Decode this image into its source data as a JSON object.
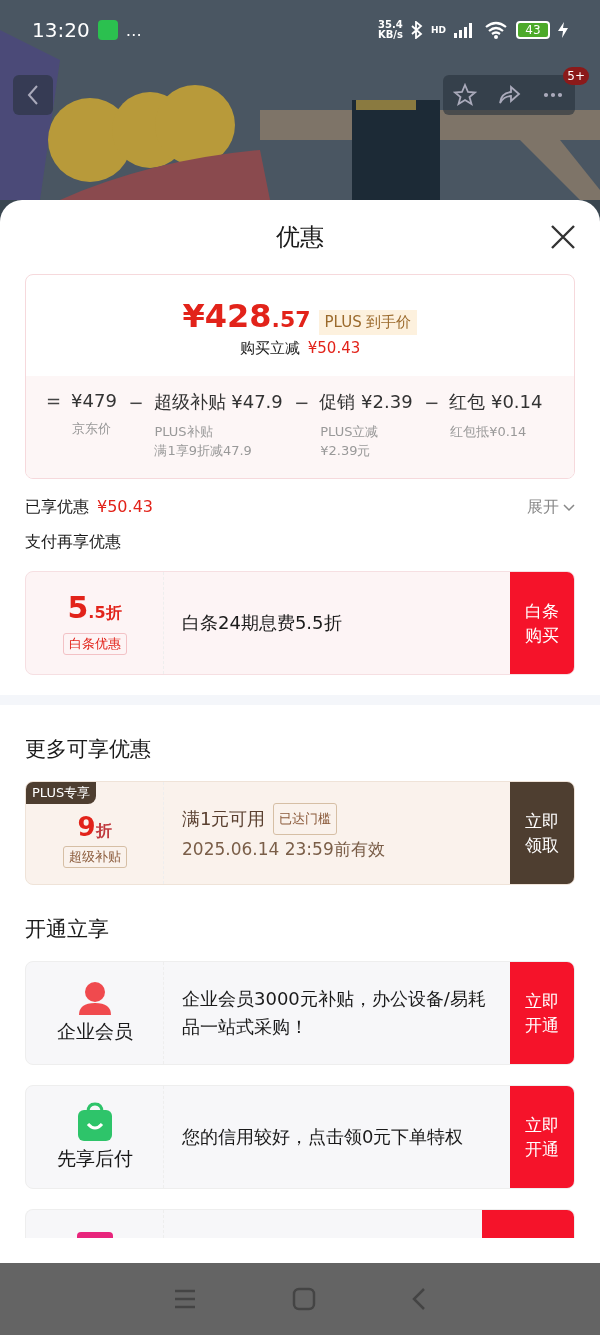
{
  "status_bar": {
    "time": "13:20",
    "more": "…",
    "speed_value": "35.4",
    "speed_unit": "KB/s",
    "network": "HD",
    "battery": "43"
  },
  "top_bar": {
    "badge": "5+"
  },
  "sheet": {
    "title": "优惠"
  },
  "price_card": {
    "price_main": "¥428",
    "price_decimal": ".57",
    "tag": "PLUS 到手价",
    "reduction_label": "购买立减",
    "reduction": "¥50.43",
    "terms": [
      {
        "op": "=",
        "amount": "¥479",
        "notes": [
          "京东价"
        ]
      },
      {
        "op": "−",
        "amount": "超级补贴 ¥47.9",
        "notes": [
          "PLUS补贴",
          "满1享9折减47.9"
        ]
      },
      {
        "op": "−",
        "amount": "促销 ¥2.39",
        "notes": [
          "PLUS立减",
          "¥2.39元"
        ]
      },
      {
        "op": "−",
        "amount": "红包 ¥0.14",
        "notes": [
          "红包抵¥0.14"
        ]
      }
    ]
  },
  "enjoyed": {
    "label": "已享优惠",
    "amount": "¥50.43",
    "expand": "展开"
  },
  "pay_section": {
    "title": "支付再享优惠",
    "offers": [
      {
        "value": "5",
        "unit": ".5折",
        "tag": "白条优惠",
        "text": "白条24期息费5.5折",
        "button": "白条购买"
      }
    ]
  },
  "more_section": {
    "title": "更多可享优惠",
    "coupons": [
      {
        "ribbon": "PLUS专享",
        "value": "9",
        "unit": "折",
        "tag": "超级补贴",
        "title": "满1元可用",
        "status": "已达门槛",
        "validity": "2025.06.14 23:59前有效",
        "button": "立即领取"
      }
    ]
  },
  "open_section": {
    "title": "开通立享",
    "services": [
      {
        "kind": "member",
        "name": "企业会员",
        "text": "企业会员3000元补贴，办公设备/易耗品一站式采购！",
        "button": "立即开通"
      },
      {
        "kind": "paylater",
        "name": "先享后付",
        "text": "您的信用较好，点击领0元下单特权",
        "button": "立即开通"
      },
      {
        "kind": "pink"
      }
    ]
  }
}
